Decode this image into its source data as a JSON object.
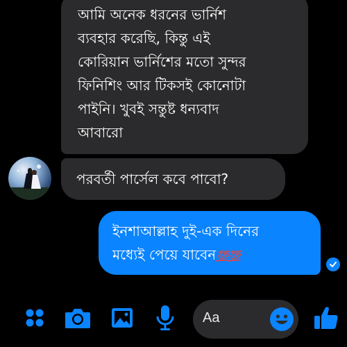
{
  "messages": [
    {
      "direction": "incoming",
      "lines": [
        "আমি অনেক ধরনের ভার্নিশ",
        "ব্যবহার করেছি, কিন্তু এই",
        "কোরিয়ান ভার্নিশের মতো সুন্দর",
        "ফিনিশিং আর টিকসই কোনোটা",
        "পাইনি। খুবই সন্তুষ্ট ধন্যবাদ",
        "আবারো"
      ]
    },
    {
      "direction": "incoming",
      "lines": [
        "পরবর্তী পার্সেল কবে পাবো?"
      ]
    },
    {
      "direction": "outgoing",
      "lines": [
        "ইনশাআল্লাহ দুই-এক দিনের",
        "মধ্যেই পেয়ে যাবেন"
      ],
      "emoji": "💯💯"
    }
  ],
  "composer": {
    "placeholder": "Aa"
  },
  "toolbar": {
    "icons": [
      "grid-icon",
      "camera-icon",
      "image-icon",
      "microphone-icon",
      "emoji-icon",
      "thumbs-up-icon"
    ]
  },
  "colors": {
    "accent": "#0a84ff",
    "incoming_bubble": "#2b2b2d",
    "background": "#000000"
  }
}
